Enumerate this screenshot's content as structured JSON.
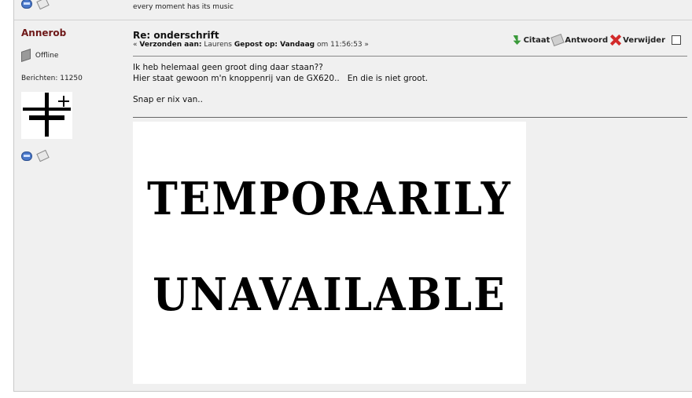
{
  "previous_post": {
    "signature": "every moment has its music",
    "icons": [
      "pm-icon",
      "email-icon"
    ]
  },
  "post": {
    "author": "Annerob",
    "status": "Offline",
    "posts_count": "Berichten: 11250",
    "subject": "Re: onderschrift",
    "meta": {
      "prefix": "« ",
      "sent_to_label": "Verzonden aan:",
      "sent_to": " Laurens ",
      "posted_label": "Gepost op: Vandaag",
      "time": " om 11:56:53 ",
      "suffix": "»"
    },
    "actions": {
      "quote": "Citaat",
      "reply": "Antwoord",
      "delete": "Verwijder"
    },
    "body": [
      "Ik heb helemaal geen groot ding daar staan??",
      "Hier staat gewoon m'n knoppenrij van de GX620..   En die is niet groot.",
      "",
      "Snap er nix van.."
    ],
    "image": {
      "line1": "TEMPORARILY",
      "line2": "UNAVAILABLE"
    }
  }
}
